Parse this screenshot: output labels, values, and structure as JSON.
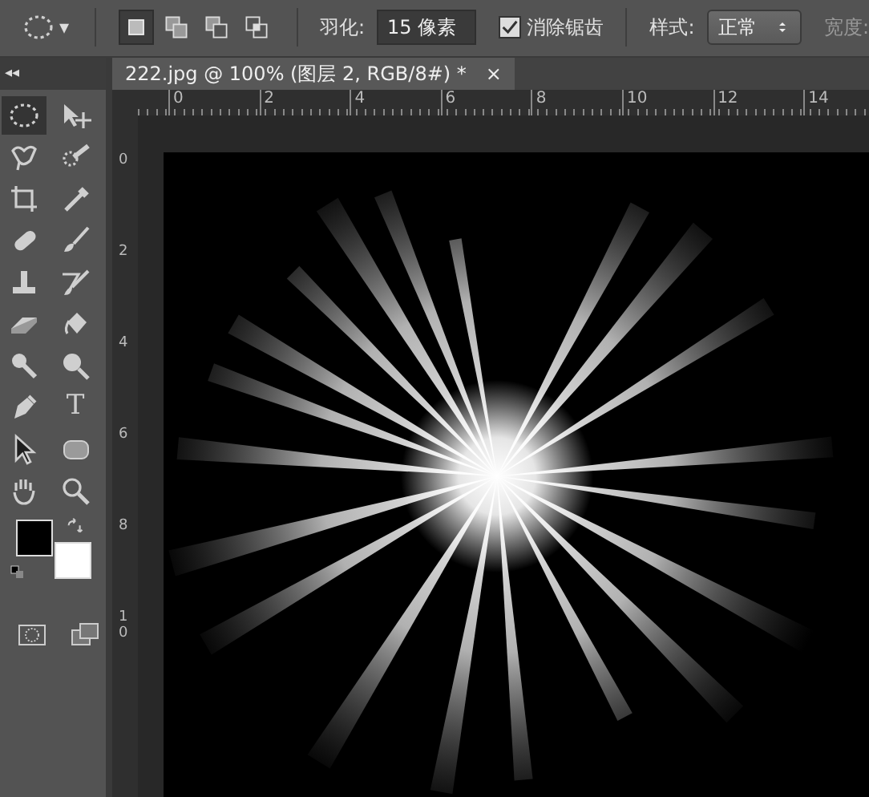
{
  "options_bar": {
    "tool_caret": "▾",
    "selection_modes": [
      {
        "kind": "new",
        "selected": true
      },
      {
        "kind": "add",
        "selected": false
      },
      {
        "kind": "subtract",
        "selected": false
      },
      {
        "kind": "intersect",
        "selected": false
      }
    ],
    "feather_label": "羽化:",
    "feather_value": "15 像素",
    "antialias": {
      "label": "消除锯齿",
      "checked": true
    },
    "style_label": "样式:",
    "style_value": "正常",
    "width_label": "宽度:"
  },
  "panel_collapse": "◂◂",
  "document_tab": {
    "title": "222.jpg @ 100% (图层 2, RGB/8#) *",
    "close": "×"
  },
  "horizontal_ruler": [
    "0",
    "2",
    "4",
    "6",
    "8",
    "10",
    "12",
    "14"
  ],
  "vertical_ruler": [
    "0",
    "2",
    "4",
    "6",
    "8",
    "10"
  ],
  "tools": [
    {
      "kind": "ellipse-marquee",
      "selected": true
    },
    {
      "kind": "move",
      "selected": false
    },
    {
      "kind": "lasso",
      "selected": false
    },
    {
      "kind": "quick-select",
      "selected": false
    },
    {
      "kind": "crop",
      "selected": false
    },
    {
      "kind": "eyedropper",
      "selected": false
    },
    {
      "kind": "healing",
      "selected": false
    },
    {
      "kind": "brush",
      "selected": false
    },
    {
      "kind": "stamp",
      "selected": false
    },
    {
      "kind": "history-brush",
      "selected": false
    },
    {
      "kind": "eraser",
      "selected": false
    },
    {
      "kind": "bucket",
      "selected": false
    },
    {
      "kind": "smudge",
      "selected": false
    },
    {
      "kind": "dodge",
      "selected": false
    },
    {
      "kind": "pen",
      "selected": false
    },
    {
      "kind": "type",
      "glyph": "T",
      "selected": false
    },
    {
      "kind": "path-select",
      "selected": false
    },
    {
      "kind": "shape",
      "selected": false
    },
    {
      "kind": "hand",
      "selected": false
    },
    {
      "kind": "zoom",
      "selected": false
    }
  ],
  "color_swatches": [
    {
      "kind": "foreground",
      "color": "#000000"
    },
    {
      "kind": "background",
      "color": "#ffffff"
    }
  ]
}
